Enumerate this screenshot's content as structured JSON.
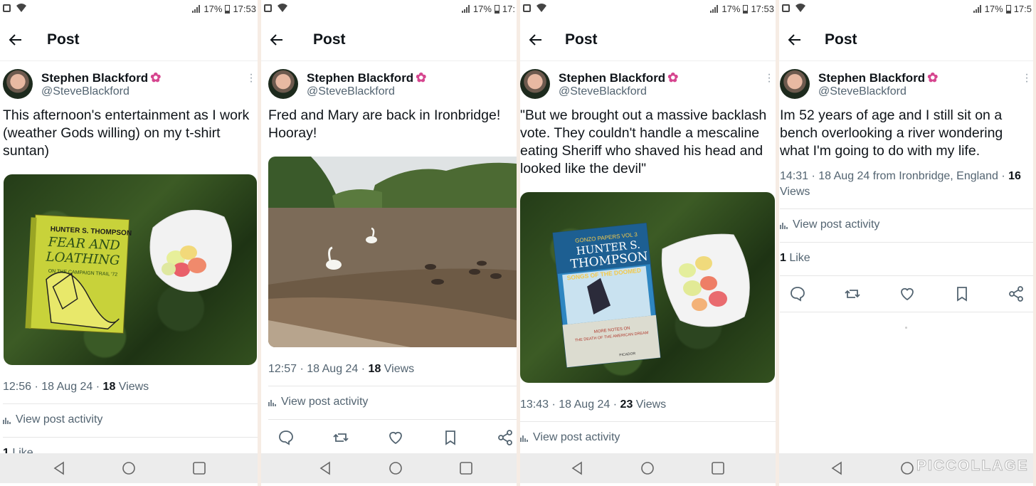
{
  "status": {
    "battery": "17%",
    "times": [
      "17:53",
      "17:",
      "17:53",
      "17:5"
    ]
  },
  "topbar": {
    "title": "Post"
  },
  "author": {
    "name": "Stephen Blackford",
    "handle": "@SteveBlackford"
  },
  "posts": [
    {
      "text": "This afternoon's entertainment as I work (weather Gods willing) on my t-shirt suntan)",
      "time": "12:56 · 18 Aug 24 · ",
      "views_count": "18",
      "views_label": " Views",
      "activity": "View post activity",
      "likes_count": "1",
      "likes_label": " Like",
      "image": {
        "book_author": "HUNTER S. THOMPSON",
        "book_title_1": "FEAR AND",
        "book_title_2": "LOATHING",
        "book_subtitle": "ON THE CAMPAIGN TRAIL '72"
      }
    },
    {
      "text": "Fred and Mary are back in Ironbridge! Hooray!",
      "time": "12:57 · 18 Aug 24 · ",
      "views_count": "18",
      "views_label": " Views",
      "activity": "View post activity"
    },
    {
      "text": "\"But we brought out a massive backlash vote. They couldn't handle a mescaline eating Sheriff who shaved his head and looked like the devil\"",
      "time": "13:43 · 18 Aug 24 · ",
      "views_count": "23",
      "views_label": " Views",
      "activity": "View post activity",
      "image": {
        "series": "GONZO PAPERS VOL 3",
        "book_author_1": "HUNTER S.",
        "book_author_2": "THOMPSON",
        "book_title": "SONGS OF THE DOOMED",
        "blurb_1": "MORE NOTES ON",
        "blurb_2": "THE DEATH OF THE AMERICAN DREAM",
        "publisher": "PICADOR"
      }
    },
    {
      "text": "Im 52 years of age and I still sit on a bench overlooking a river wondering what I'm going to do with my life.",
      "time": "14:31 · 18 Aug 24 from Ironbridge, England · ",
      "views_count": "16",
      "views_label": " Views",
      "activity": "View post activity",
      "likes_count": "1",
      "likes_label": " Like"
    }
  ],
  "watermark": "PICCOLLAGE",
  "colors": {
    "flower": "#d6468f",
    "secondary_text": "#536471"
  }
}
